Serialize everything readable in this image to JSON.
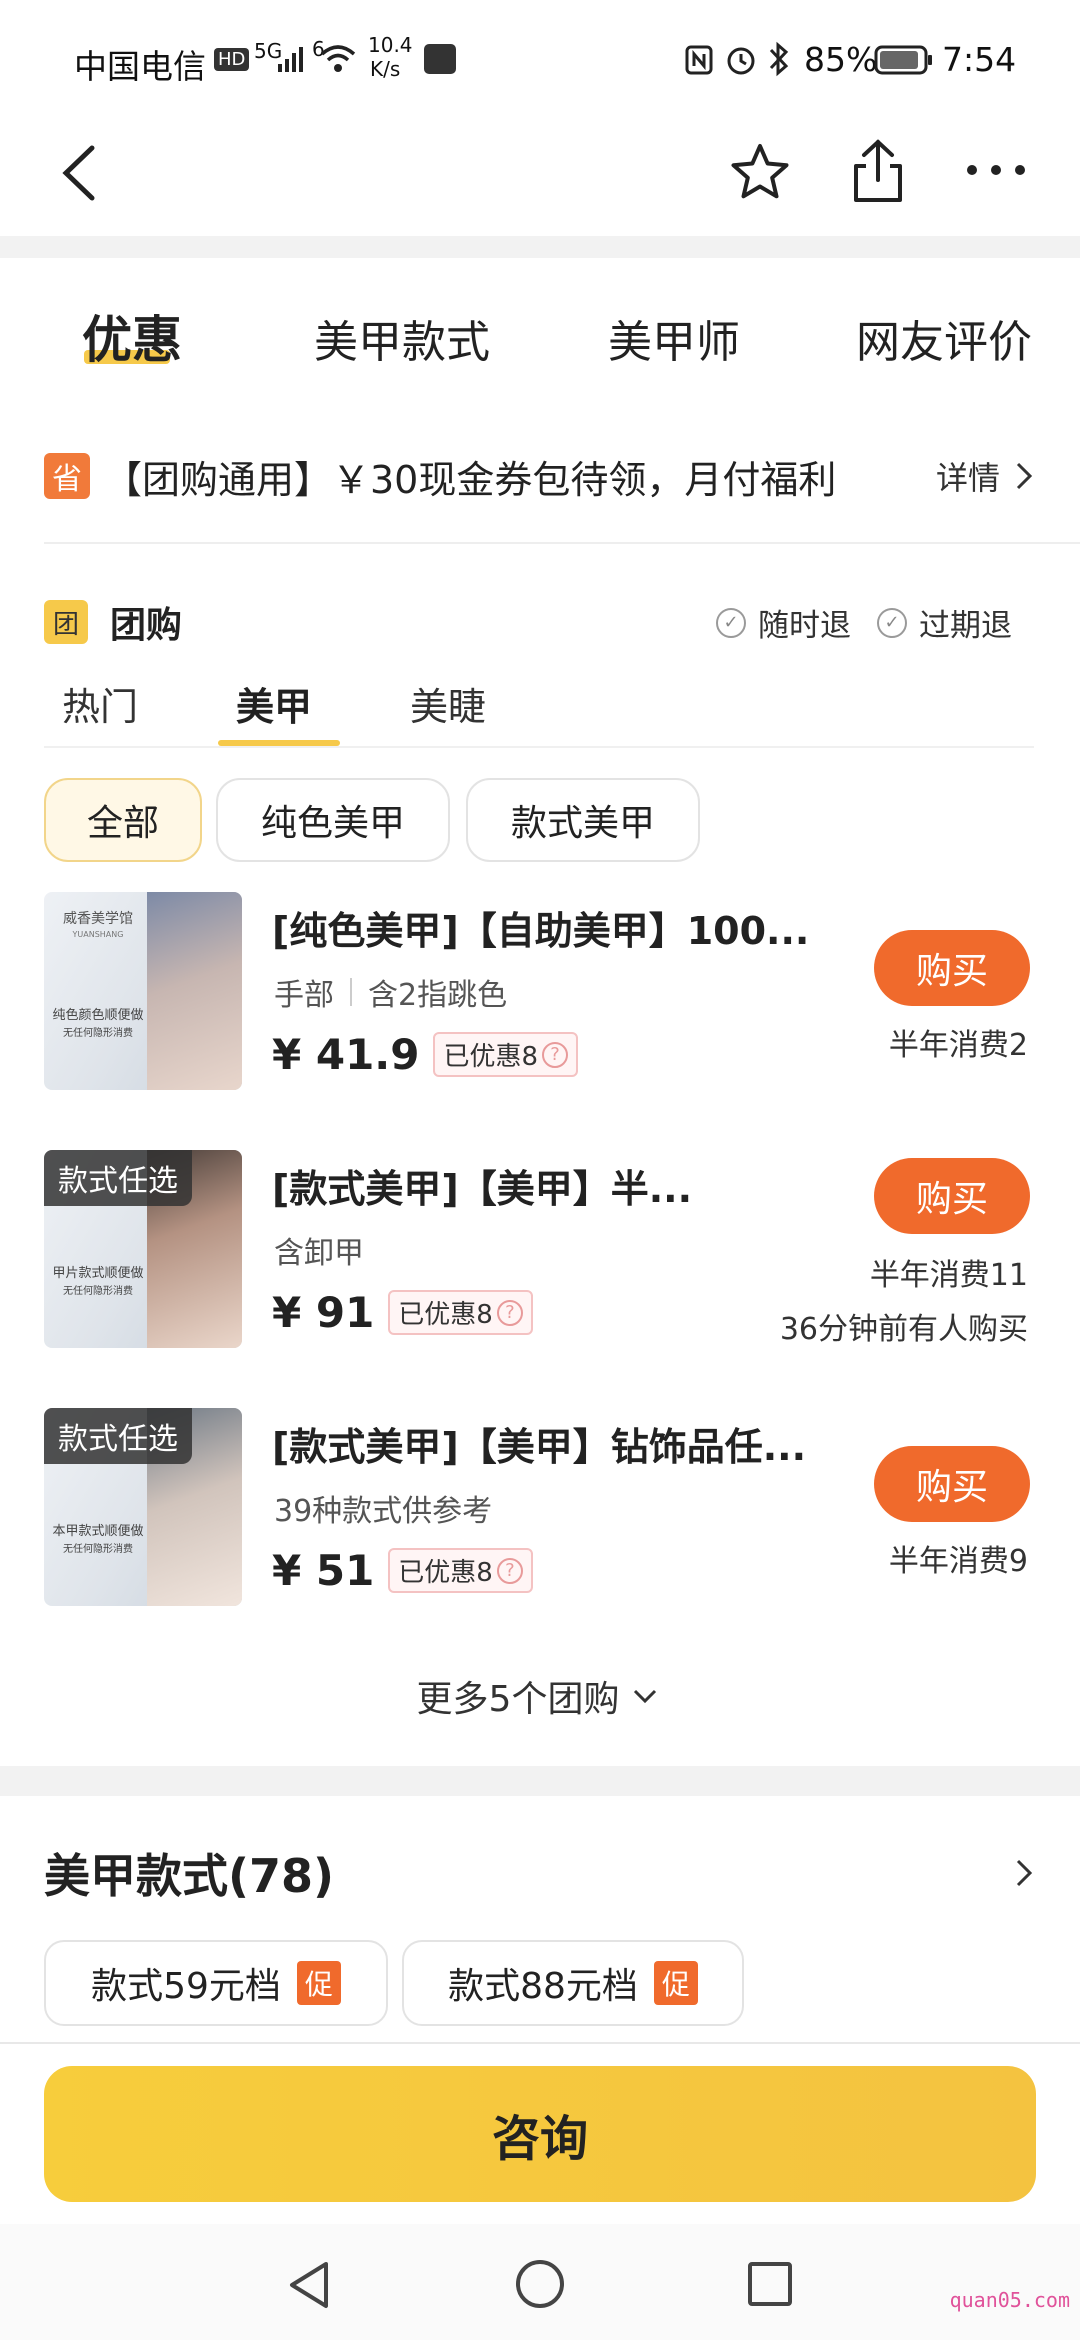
{
  "status_bar": {
    "carrier": "中国电信",
    "hd": "HD",
    "net_5g": "5G",
    "wifi_num": "6",
    "speed_value": "10.4",
    "speed_unit": "K/s",
    "battery": "85%",
    "time": "7:54",
    "icons": [
      "nfc-icon",
      "alarm-icon",
      "bluetooth-icon",
      "battery-icon"
    ]
  },
  "nav": {
    "icons": [
      "back-icon",
      "star-icon",
      "share-icon",
      "more-icon"
    ]
  },
  "main_tabs": [
    "优惠",
    "美甲款式",
    "美甲师",
    "网友评价"
  ],
  "promo": {
    "badge": "省",
    "text": "【团购通用】￥30现金券包待领，月付福利",
    "detail": "详情"
  },
  "group": {
    "badge": "团",
    "title": "团购",
    "refund1": "随时退",
    "refund2": "过期退",
    "subtabs": [
      "热门",
      "美甲",
      "美睫"
    ],
    "chips": [
      "全部",
      "纯色美甲",
      "款式美甲"
    ]
  },
  "deals": [
    {
      "title": "[纯色美甲]【自助美甲】100...",
      "sub1": "手部",
      "sub2": "含2指跳色",
      "price": "¥ 41.9",
      "discount": "已优惠8",
      "buy": "购买",
      "sold": "半年消费2",
      "note": "",
      "tag": "",
      "thumb_top": "威香美学馆",
      "thumb_top2": "YUANSHANG",
      "thumb_cap1": "纯色颜色顺便做",
      "thumb_cap2": "无任何隐形消费"
    },
    {
      "title": "[款式美甲]【美甲】半...",
      "sub1": "含卸甲",
      "sub2": "",
      "price": "¥ 91",
      "discount": "已优惠8",
      "buy": "购买",
      "sold": "半年消费11",
      "note": "36分钟前有人购买",
      "tag": "款式任选",
      "thumb_top": "",
      "thumb_top2": "",
      "thumb_cap1": "甲片款式顺便做",
      "thumb_cap2": "无任何隐形消费"
    },
    {
      "title": "[款式美甲]【美甲】钻饰品任...",
      "sub1": "39种款式供参考",
      "sub2": "",
      "price": "¥ 51",
      "discount": "已优惠8",
      "buy": "购买",
      "sold": "半年消费9",
      "note": "",
      "tag": "款式任选",
      "thumb_top": "",
      "thumb_top2": "",
      "thumb_cap1": "本甲款式顺便做",
      "thumb_cap2": "无任何隐形消费"
    }
  ],
  "more_deals": "更多5个团购",
  "styles": {
    "title": "美甲款式(78)",
    "chips": [
      {
        "label": "款式59元档",
        "badge": "促"
      },
      {
        "label": "款式88元档",
        "badge": "促"
      }
    ]
  },
  "cta": "咨询",
  "watermark": "quan05.com",
  "colors": {
    "accent_yellow": "#f6c94a",
    "buy_orange": "#f06a2c",
    "cta_yellow": "#f7cd3c"
  }
}
